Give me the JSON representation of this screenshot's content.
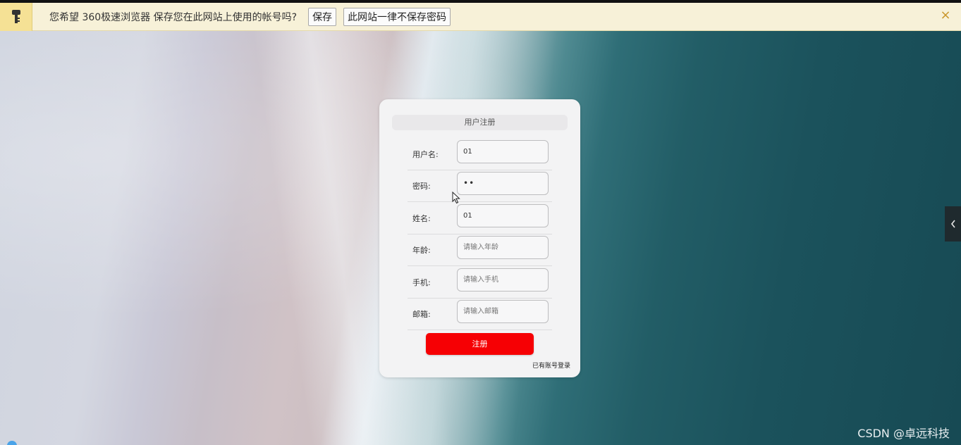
{
  "savebar": {
    "message": "您希望 360极速浏览器 保存您在此网站上使用的帐号吗?",
    "save_label": "保存",
    "never_label": "此网站一律不保存密码",
    "close_glyph": "×",
    "key_icon": "key-icon"
  },
  "form": {
    "title": "用户注册",
    "fields": [
      {
        "label": "用户名:",
        "value": "01",
        "placeholder": ""
      },
      {
        "label": "密码:",
        "value": "••",
        "placeholder": ""
      },
      {
        "label": "姓名:",
        "value": "01",
        "placeholder": ""
      },
      {
        "label": "年龄:",
        "value": "",
        "placeholder": "请输入年龄"
      },
      {
        "label": "手机:",
        "value": "",
        "placeholder": "请输入手机"
      },
      {
        "label": "邮箱:",
        "value": "",
        "placeholder": "请输入邮箱"
      }
    ],
    "submit_label": "注册",
    "login_link": "已有账号登录",
    "submit_color": "#f60004"
  },
  "side_tab": {
    "icon": "chevron-left-icon"
  },
  "watermark": "CSDN @卓远科技"
}
